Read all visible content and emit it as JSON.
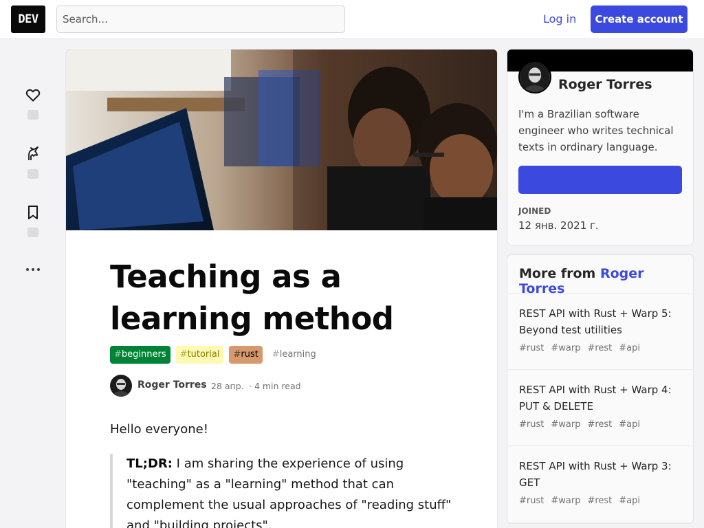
{
  "header": {
    "logo": "DEV",
    "search_placeholder": "Search...",
    "login": "Log in",
    "create_account": "Create account"
  },
  "article": {
    "title": "Teaching as a learning method",
    "tags": [
      {
        "hash": "#",
        "name": "beginners",
        "bg": "#008335",
        "fg": "#ffffff"
      },
      {
        "hash": "#",
        "name": "tutorial",
        "bg": "#fff9b2",
        "fg": "#8a7d00"
      },
      {
        "hash": "#",
        "name": "rust",
        "bg": "#d5996c",
        "fg": "#000000"
      },
      {
        "hash": "#",
        "name": "learning",
        "bg": "transparent",
        "fg": "#717171"
      }
    ],
    "author": "Roger Torres",
    "date": "28 апр.",
    "read_time": "· 4 min read",
    "greeting": "Hello everyone!",
    "tldr_label": "TL;DR:",
    "tldr_text": " I am sharing the experience of using \"teaching\" as a \"learning\" method that can complement the usual approaches of \"reading stuff\" and \"building projects\"."
  },
  "profile": {
    "name": "Roger Torres",
    "bio": "I'm a Brazilian software engineer who writes technical texts in ordinary language.",
    "joined_label": "JOINED",
    "joined_date": "12 янв. 2021 г."
  },
  "more_from": {
    "prefix": "More from ",
    "author": "Roger Torres",
    "items": [
      {
        "title": "REST API with Rust + Warp 5: Beyond test utilities",
        "tags": [
          "#rust",
          "#warp",
          "#rest",
          "#api"
        ]
      },
      {
        "title": "REST API with Rust + Warp 4: PUT & DELETE",
        "tags": [
          "#rust",
          "#warp",
          "#rest",
          "#api"
        ]
      },
      {
        "title": "REST API with Rust + Warp 3: GET",
        "tags": [
          "#rust",
          "#warp",
          "#rest",
          "#api"
        ]
      }
    ]
  },
  "colors": {
    "accent": "#3b49df",
    "profile_band": "#000000"
  },
  "icons": [
    "heart-icon",
    "unicorn-icon",
    "bookmark-icon",
    "more-icon"
  ]
}
